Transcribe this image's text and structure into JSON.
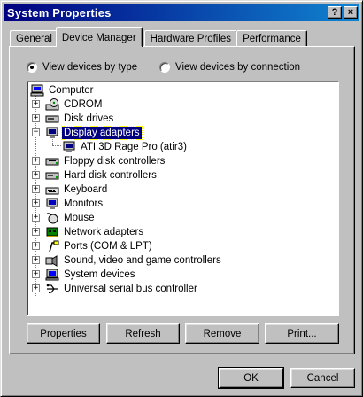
{
  "window": {
    "title": "System Properties",
    "help_button": "?",
    "close_button": "×"
  },
  "tabs": [
    {
      "label": "General",
      "active": false
    },
    {
      "label": "Device Manager",
      "active": true
    },
    {
      "label": "Hardware Profiles",
      "active": false
    },
    {
      "label": "Performance",
      "active": false
    }
  ],
  "view_options": {
    "by_type": {
      "label": "View devices by type",
      "selected": true
    },
    "by_connection": {
      "label": "View devices by connection",
      "selected": false
    }
  },
  "tree": {
    "root": {
      "label": "Computer",
      "icon": "computer-icon"
    },
    "items": [
      {
        "label": "CDROM",
        "icon": "cdrom-icon",
        "expander": "+"
      },
      {
        "label": "Disk drives",
        "icon": "disk-drive-icon",
        "expander": "+"
      },
      {
        "label": "Display adapters",
        "icon": "monitor-icon",
        "expander": "−",
        "selected": true
      },
      {
        "label": "ATI 3D Rage Pro (atir3)",
        "icon": "monitor-icon",
        "child": true
      },
      {
        "label": "Floppy disk controllers",
        "icon": "floppy-controller-icon",
        "expander": "+"
      },
      {
        "label": "Hard disk controllers",
        "icon": "hdd-controller-icon",
        "expander": "+"
      },
      {
        "label": "Keyboard",
        "icon": "keyboard-icon",
        "expander": "+"
      },
      {
        "label": "Monitors",
        "icon": "monitor-icon",
        "expander": "+"
      },
      {
        "label": "Mouse",
        "icon": "mouse-icon",
        "expander": "+"
      },
      {
        "label": "Network adapters",
        "icon": "network-adapter-icon",
        "expander": "+"
      },
      {
        "label": "Ports (COM & LPT)",
        "icon": "port-icon",
        "expander": "+"
      },
      {
        "label": "Sound, video and game controllers",
        "icon": "sound-icon",
        "expander": "+"
      },
      {
        "label": "System devices",
        "icon": "system-device-icon",
        "expander": "+"
      },
      {
        "label": "Universal serial bus controller",
        "icon": "usb-icon",
        "expander": "+"
      }
    ]
  },
  "actions": {
    "properties": "Properties",
    "refresh": "Refresh",
    "remove": "Remove",
    "print": "Print..."
  },
  "footer": {
    "ok": "OK",
    "cancel": "Cancel"
  },
  "colors": {
    "titlebar_start": "#000080",
    "titlebar_end": "#1084d0",
    "selection": "#000080",
    "face": "#c0c0c0"
  }
}
